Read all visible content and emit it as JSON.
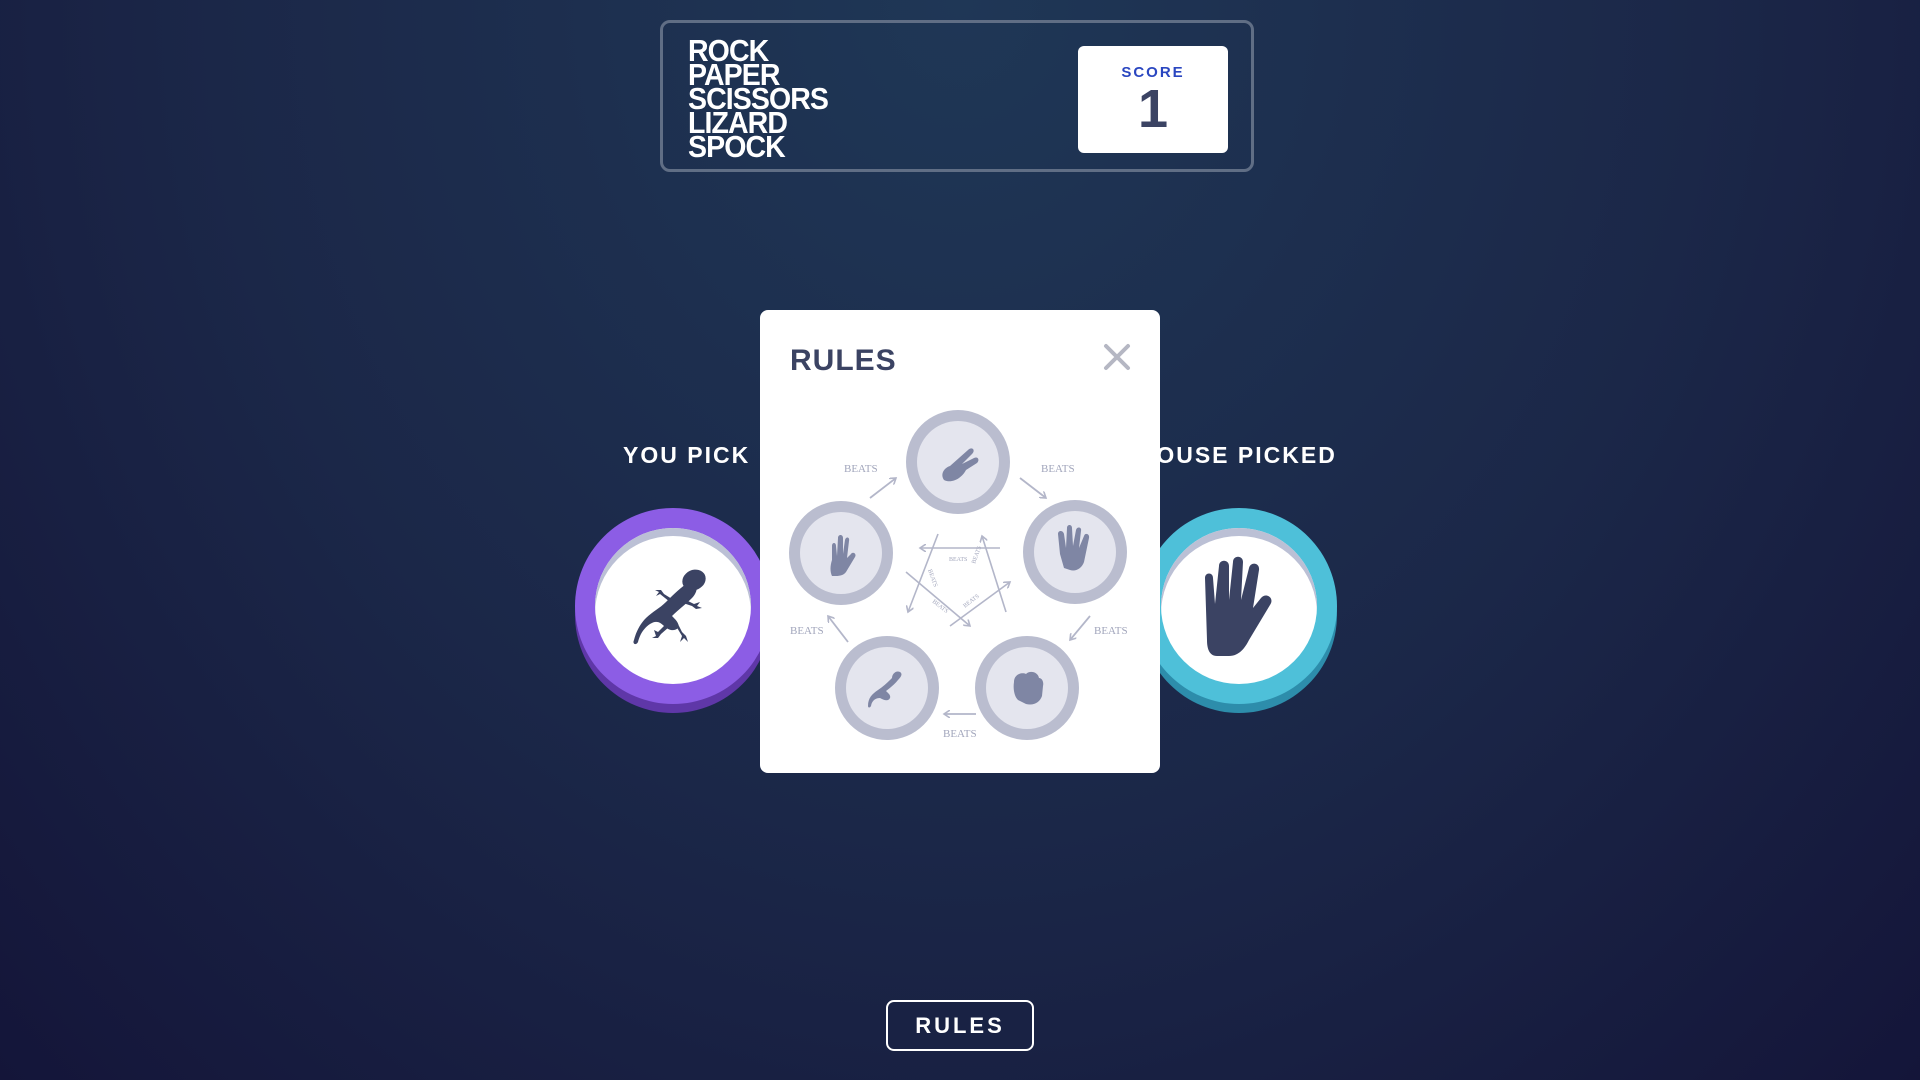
{
  "header": {
    "title_lines": [
      "ROCK",
      "PAPER",
      "SCISSORS",
      "LIZARD",
      "SPOCK"
    ],
    "score_label": "SCORE",
    "score_value": "1"
  },
  "game": {
    "you_label": "YOU PICK",
    "house_label": "E HOUSE PICKED",
    "player_choice": "lizard",
    "house_choice": "spock",
    "colors": {
      "lizard": "#8c5de5",
      "spock": "#4ec0d9",
      "icon": "#3b4363"
    }
  },
  "rules_modal": {
    "title": "RULES",
    "close_icon": "close-icon",
    "beats_label": "BEATS"
  },
  "footer": {
    "rules_button_label": "RULES"
  }
}
